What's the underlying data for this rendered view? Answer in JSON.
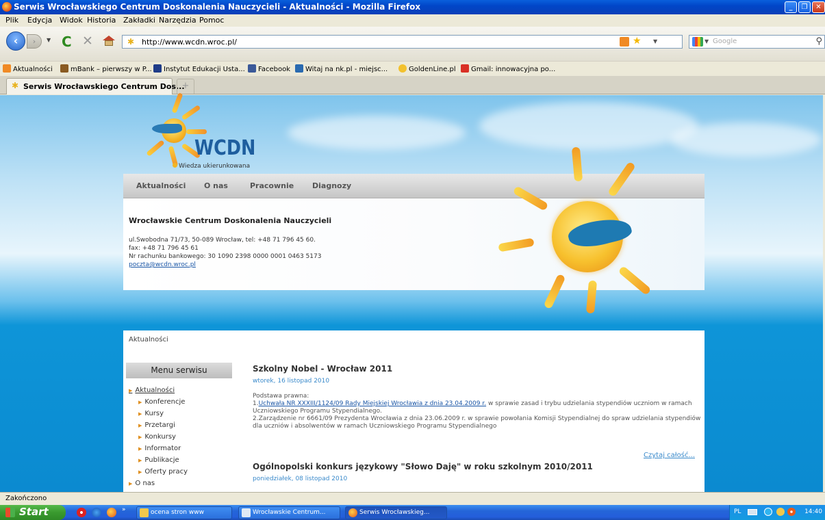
{
  "window": {
    "title": "Serwis Wrocławskiego Centrum Doskonalenia Nauczycieli - Aktualności - Mozilla Firefox"
  },
  "menu": [
    "Plik",
    "Edycja",
    "Widok",
    "Historia",
    "Zakładki",
    "Narzędzia",
    "Pomoc"
  ],
  "navigation": {
    "url": "http://www.wcdn.wroc.pl/",
    "search_placeholder": "Google"
  },
  "bookmarks": [
    {
      "label": "Aktualności",
      "color": "#f08a24"
    },
    {
      "label": "mBank – pierwszy w P...",
      "color": "#8a5b22"
    },
    {
      "label": "Instytut Edukacji Usta...",
      "color": "#1f3c88"
    },
    {
      "label": "Facebook",
      "color": "#3b5998"
    },
    {
      "label": "Witaj na nk.pl - miejsc...",
      "color": "#2a6ab0"
    },
    {
      "label": "GoldenLine.pl",
      "color": "#f2c12e"
    },
    {
      "label": "Gmail: innowacyjna po...",
      "color": "#d93025"
    }
  ],
  "tab": {
    "label": "Serwis Wrocławskiego Centrum Dos...",
    "newtab": "+"
  },
  "site": {
    "logo_text": "WCDN",
    "tagline": "Wiedza ukierunkowana",
    "nav": [
      "Aktualności",
      "O nas",
      "Pracownie",
      "Diagnozy"
    ],
    "info": {
      "title": "Wrocławskie Centrum Doskonalenia Nauczycieli",
      "address": "ul.Swobodna 71/73, 50-089 Wrocław, tel: +48 71 796 45 60.",
      "fax": "fax: +48 71 796 45 61",
      "account": "Nr rachunku bankowego: 30 1090 2398 0000 0001 0463 5173",
      "email": "poczta@wcdn.wroc.pl"
    },
    "breadcrumb": "Aktualności",
    "sidebar": {
      "title": "Menu serwisu",
      "main": "Aktualności",
      "items": [
        "Konferencje",
        "Kursy",
        "Przetargi",
        "Konkursy",
        "Informator",
        "Publikacje",
        "Oferty pracy"
      ],
      "next": "O nas"
    },
    "articles": [
      {
        "title": "Szkolny Nobel - Wrocław 2011",
        "date": "wtorek, 16 listopad 2010",
        "basis": "Podstawa prawna:",
        "line1_prefix": "1.",
        "line1_link": "Uchwała NR XXXIII/1124/09 Rady Miejskiej Wrocławia z dnia 23.04.2009 r.",
        "line1_rest": " w sprawie zasad i trybu udzielania stypendiów uczniom w ramach Uczniowskiego Programu Stypendialnego.",
        "line2": "2.Zarządzenie nr 6661/09 Prezydenta Wrocławia z dnia 23.06.2009 r. w sprawie powołania Komisji Stypendialnej do spraw udzielania stypendiów dla uczniów i absolwentów w ramach Uczniowskiego Programu Stypendialnego",
        "readmore": "Czytaj całość..."
      },
      {
        "title": "Ogólnopolski konkurs językowy \"Słowo Daję\" w roku szkolnym 2010/2011",
        "date": "poniedziałek, 08 listopad 2010"
      }
    ]
  },
  "status": "Zakończono",
  "taskbar": {
    "start": "Start",
    "tasks": [
      "ocena stron www",
      "Wrocławskie Centrum...",
      "Serwis Wrocławskieg..."
    ],
    "lang": "PL",
    "clock": "14:40"
  }
}
